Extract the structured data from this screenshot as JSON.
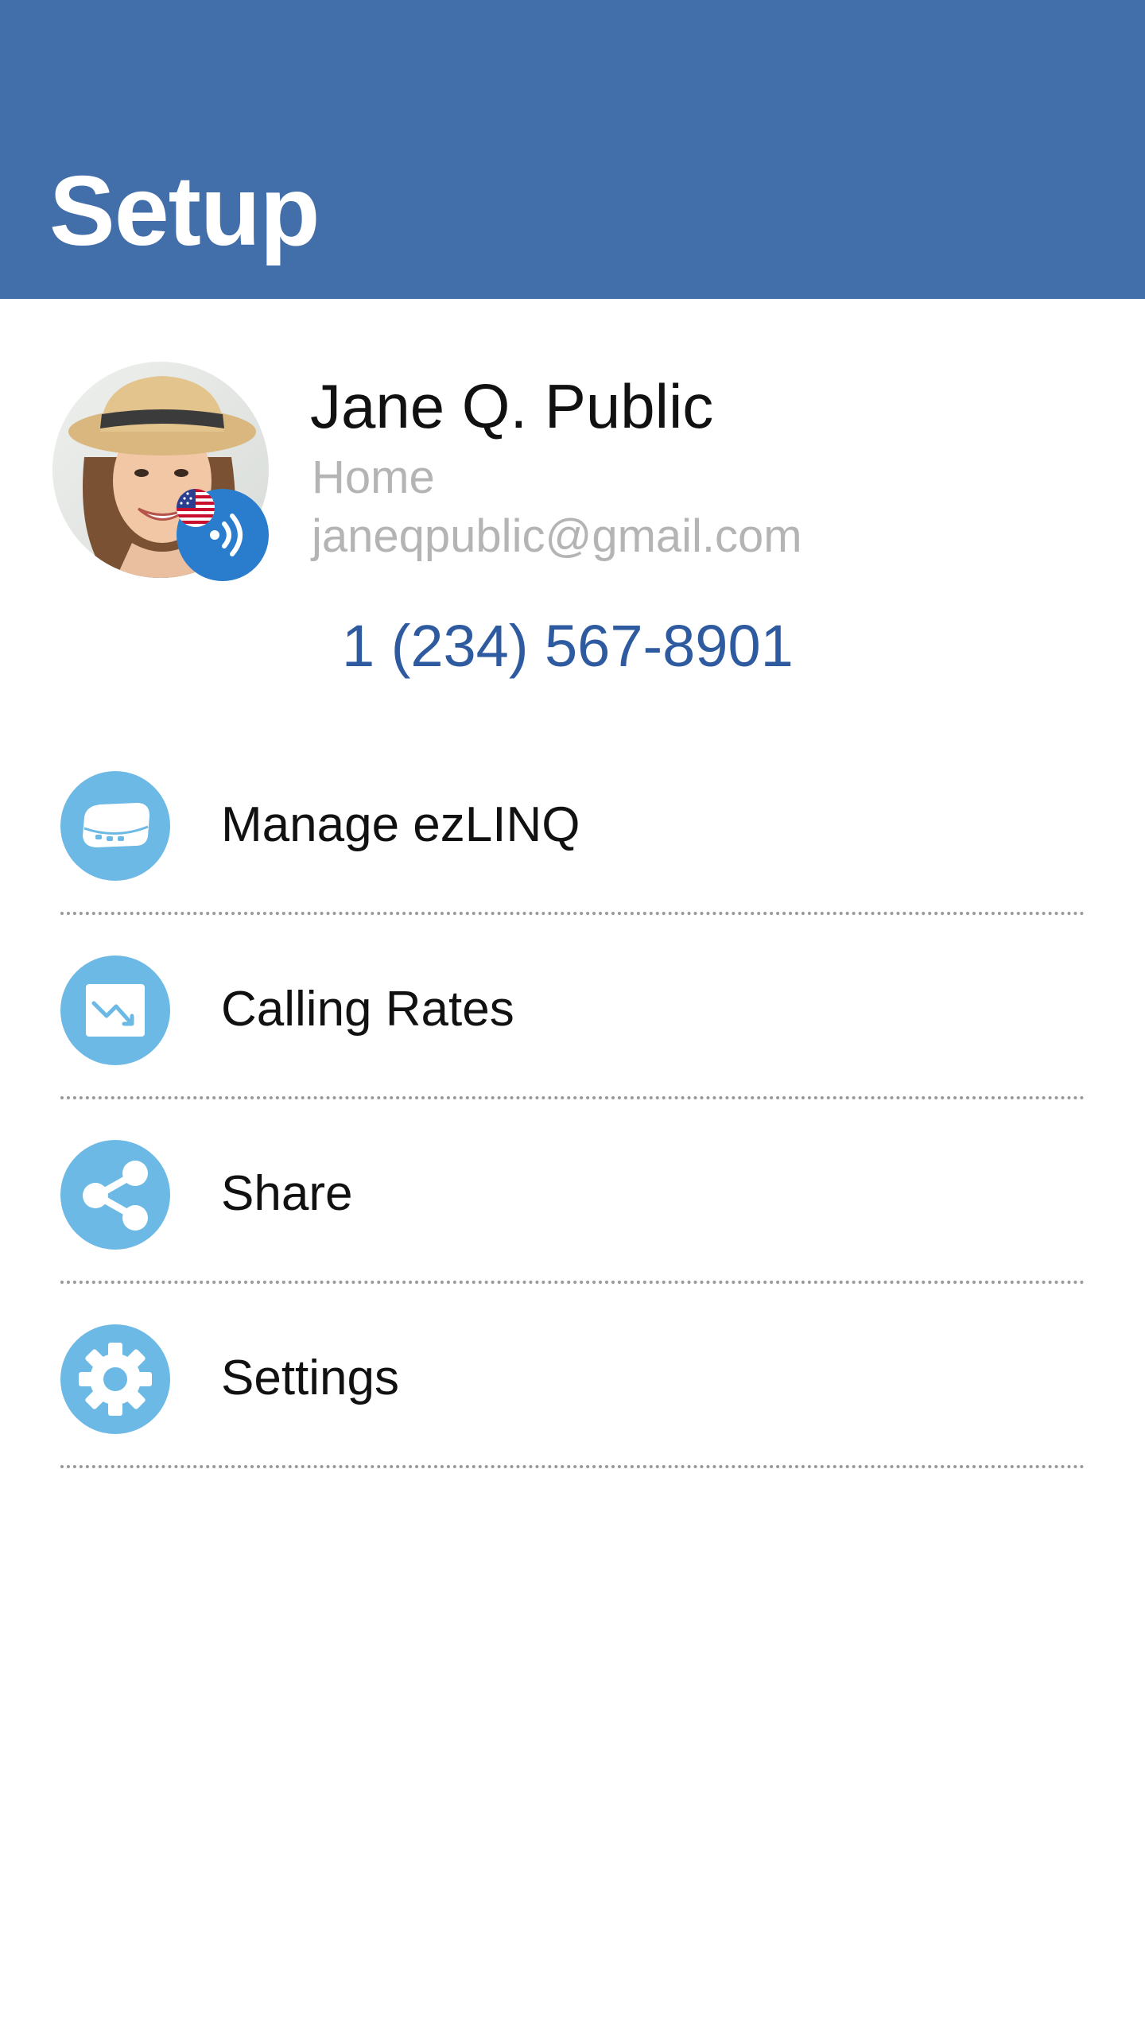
{
  "header": {
    "title": "Setup",
    "background_color": "#426ea9"
  },
  "profile": {
    "name": "Jane Q. Public",
    "location": "Home",
    "email": "janeqpublic@gmail.com",
    "phone": "1 (234) 567-8901",
    "avatar_icon": "user-photo",
    "flag_icon": "us-flag-icon",
    "presence_icon": "wireless-signal-icon",
    "phone_color": "#2e5aa0"
  },
  "menu": {
    "items": [
      {
        "label": "Manage ezLINQ",
        "icon": "router-device-icon"
      },
      {
        "label": "Calling Rates",
        "icon": "rates-chart-icon"
      },
      {
        "label": "Share",
        "icon": "share-icon"
      },
      {
        "label": "Settings",
        "icon": "gear-icon"
      }
    ],
    "icon_color": "#6cb9e5"
  }
}
